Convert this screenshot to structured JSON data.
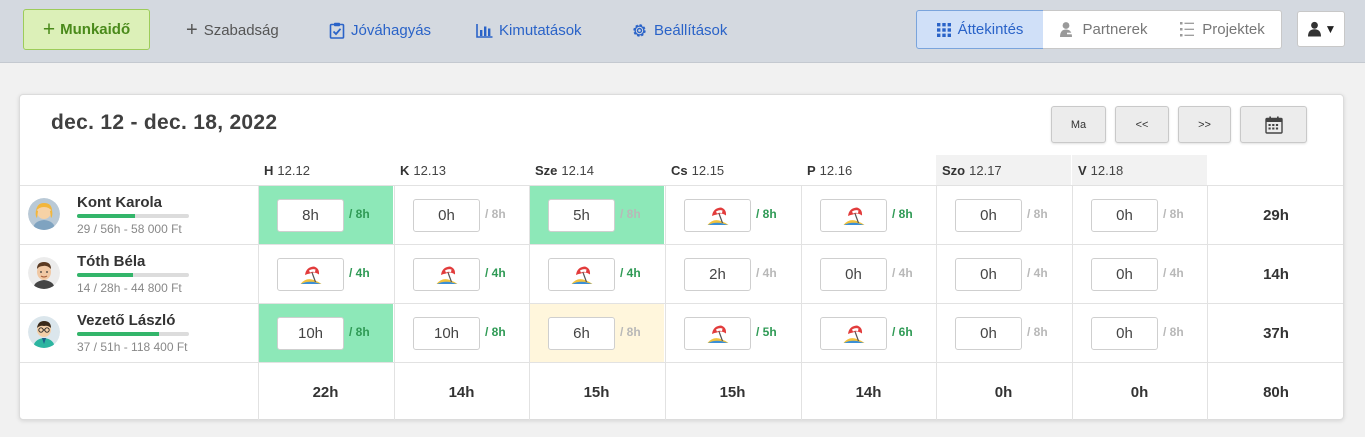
{
  "toolbar": {
    "main_button": "Munkaidő",
    "links": [
      "Szabadság",
      "Jóváhagyás",
      "Kimutatások",
      "Beállítások"
    ],
    "segments": [
      "Áttekintés",
      "Partnerek",
      "Projektek"
    ],
    "active_segment": "Áttekintés",
    "accent_color": "#2a63c8",
    "main_color": "#4a8a1a",
    "icons": [
      "plus-icon",
      "plus-icon",
      "clipboard-check-icon",
      "bar-chart-icon",
      "gear-icon",
      "grid-icon",
      "partner-icon",
      "list-icon",
      "user-icon",
      "caret-down-icon"
    ]
  },
  "calendar": {
    "range": "dec. 12 - dec. 18, 2022",
    "buttons": {
      "today": "Ma",
      "prev": "<<",
      "next": ">>"
    },
    "days": [
      {
        "abbr": "H",
        "date": "12.12"
      },
      {
        "abbr": "K",
        "date": "12.13"
      },
      {
        "abbr": "Sze",
        "date": "12.14"
      },
      {
        "abbr": "Cs",
        "date": "12.15"
      },
      {
        "abbr": "P",
        "date": "12.16"
      },
      {
        "abbr": "Szo",
        "date": "12.17"
      },
      {
        "abbr": "V",
        "date": "12.18"
      }
    ],
    "employees": [
      {
        "name": "Kont Karola",
        "stat": "29 / 56h - 58 000 Ft",
        "progress": 0.52,
        "total": "29h",
        "cells": [
          {
            "kind": "hours",
            "value": "8h",
            "quota": "/ 8h",
            "quota_green": true,
            "bg": "green"
          },
          {
            "kind": "hours",
            "value": "0h",
            "quota": "/ 8h",
            "quota_green": false,
            "bg": ""
          },
          {
            "kind": "hours",
            "value": "5h",
            "quota": "/ 8h",
            "quota_green": false,
            "bg": "green"
          },
          {
            "kind": "vacation",
            "quota": "/ 8h",
            "quota_green": true,
            "bg": ""
          },
          {
            "kind": "vacation",
            "quota": "/ 8h",
            "quota_green": true,
            "bg": ""
          },
          {
            "kind": "hours",
            "value": "0h",
            "quota": "/ 8h",
            "quota_green": false,
            "bg": ""
          },
          {
            "kind": "hours",
            "value": "0h",
            "quota": "/ 8h",
            "quota_green": false,
            "bg": ""
          }
        ]
      },
      {
        "name": "Tóth Béla",
        "stat": "14 / 28h - 44 800 Ft",
        "progress": 0.5,
        "total": "14h",
        "cells": [
          {
            "kind": "vacation",
            "quota": "/ 4h",
            "quota_green": true,
            "bg": ""
          },
          {
            "kind": "vacation",
            "quota": "/ 4h",
            "quota_green": true,
            "bg": ""
          },
          {
            "kind": "vacation",
            "quota": "/ 4h",
            "quota_green": true,
            "bg": ""
          },
          {
            "kind": "hours",
            "value": "2h",
            "quota": "/ 4h",
            "quota_green": false,
            "bg": ""
          },
          {
            "kind": "hours",
            "value": "0h",
            "quota": "/ 4h",
            "quota_green": false,
            "bg": ""
          },
          {
            "kind": "hours",
            "value": "0h",
            "quota": "/ 4h",
            "quota_green": false,
            "bg": ""
          },
          {
            "kind": "hours",
            "value": "0h",
            "quota": "/ 4h",
            "quota_green": false,
            "bg": ""
          }
        ]
      },
      {
        "name": "Vezető László",
        "stat": "37 / 51h - 118 400 Ft",
        "progress": 0.73,
        "total": "37h",
        "cells": [
          {
            "kind": "hours",
            "value": "10h",
            "quota": "/ 8h",
            "quota_green": true,
            "bg": "green"
          },
          {
            "kind": "hours",
            "value": "10h",
            "quota": "/ 8h",
            "quota_green": true,
            "bg": ""
          },
          {
            "kind": "hours",
            "value": "6h",
            "quota": "/ 8h",
            "quota_green": false,
            "bg": "yellow"
          },
          {
            "kind": "vacation",
            "quota": "/ 5h",
            "quota_green": true,
            "bg": ""
          },
          {
            "kind": "vacation",
            "quota": "/ 6h",
            "quota_green": true,
            "bg": ""
          },
          {
            "kind": "hours",
            "value": "0h",
            "quota": "/ 8h",
            "quota_green": false,
            "bg": ""
          },
          {
            "kind": "hours",
            "value": "0h",
            "quota": "/ 8h",
            "quota_green": false,
            "bg": ""
          }
        ]
      }
    ],
    "day_totals": [
      "22h",
      "14h",
      "15h",
      "15h",
      "14h",
      "0h",
      "0h"
    ],
    "grand_total": "80h"
  }
}
